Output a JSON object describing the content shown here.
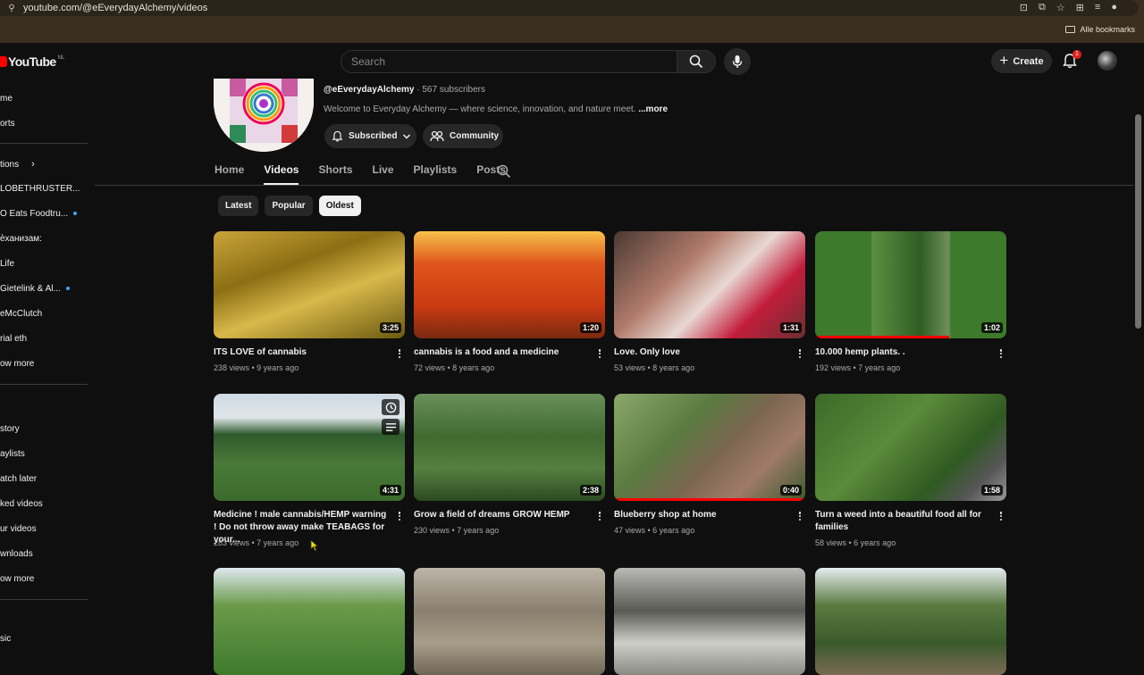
{
  "browser": {
    "url": "youtube.com/@eEverydayAlchemy/videos",
    "bookmarks_label": "Alle bookmarks"
  },
  "masthead": {
    "logo_text": "YouTube",
    "logo_region": "NL",
    "search_placeholder": "Search",
    "create_label": "Create",
    "notification_count": "1"
  },
  "sidebar": {
    "items": [
      {
        "label": "me"
      },
      {
        "label": "orts"
      },
      {
        "label": "tions"
      },
      {
        "label": "LOBETHRUSTER..."
      },
      {
        "label": "O Eats Foodtru...",
        "new": true
      },
      {
        "label": "ѐханизам:"
      },
      {
        "label": "Life"
      },
      {
        "label": " Gietelink & Al...",
        "new": true
      },
      {
        "label": "eMcClutch"
      },
      {
        "label": "rial eth"
      },
      {
        "label": "ow more"
      },
      {
        "label": "story"
      },
      {
        "label": "aylists"
      },
      {
        "label": "atch later"
      },
      {
        "label": "ked videos"
      },
      {
        "label": "ur videos"
      },
      {
        "label": "wnloads"
      },
      {
        "label": "ow more"
      },
      {
        "label": "sic"
      }
    ]
  },
  "channel": {
    "handle": "@eEverydayAlchemy",
    "subscribers": "· 567 subscribers",
    "description": "Welcome to Everyday Alchemy — where science, innovation, and nature meet.",
    "more_label": "...more",
    "subscribed_label": "Subscribed",
    "community_label": "Community"
  },
  "tabs": [
    "Home",
    "Videos",
    "Shorts",
    "Live",
    "Playlists",
    "Posts"
  ],
  "active_tab": "Videos",
  "chips": [
    "Latest",
    "Popular",
    "Oldest"
  ],
  "active_chip": "Oldest",
  "videos": [
    {
      "title": "ITS LOVE of cannabis",
      "meta": "238 views • 9 years ago",
      "duration": "3:25"
    },
    {
      "title": "cannabis is a food and a medicine",
      "meta": "72 views • 8 years ago",
      "duration": "1:20"
    },
    {
      "title": "Love. Only love",
      "meta": "53 views • 8 years ago",
      "duration": "1:31"
    },
    {
      "title": "10.000 hemp plants. .",
      "meta": "192 views • 7 years ago",
      "duration": "1:02",
      "progress": 0.7
    },
    {
      "title": "Medicine ! male cannabis/HEMP warning ! Do not throw away make TEABAGS for your...",
      "meta": "283 views • 7 years ago",
      "duration": "4:31"
    },
    {
      "title": "Grow a field of dreams GROW HEMP",
      "meta": "230 views • 7 years ago",
      "duration": "2:38"
    },
    {
      "title": "Blueberry shop at home",
      "meta": "47 views • 6 years ago",
      "duration": "0:40",
      "progress": 1.0
    },
    {
      "title": "Turn a weed into a beautiful food all for families",
      "meta": "58 views • 6 years ago",
      "duration": "1:58"
    },
    {
      "title": "",
      "meta": "",
      "duration": ""
    },
    {
      "title": "",
      "meta": "",
      "duration": ""
    },
    {
      "title": "",
      "meta": "",
      "duration": ""
    },
    {
      "title": "",
      "meta": "",
      "duration": ""
    }
  ]
}
